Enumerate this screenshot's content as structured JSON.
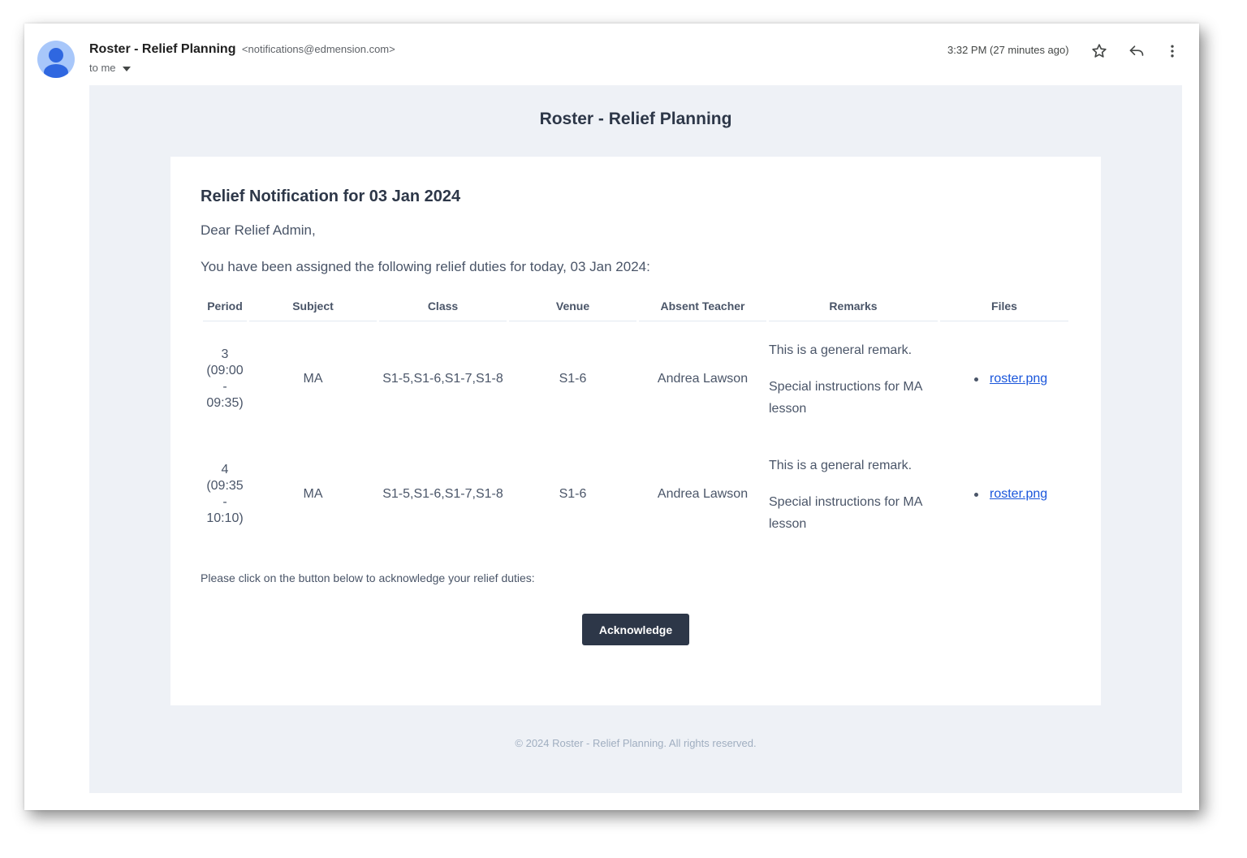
{
  "header": {
    "sender_name": "Roster - Relief Planning",
    "sender_email": "<notifications@edmension.com>",
    "recipient": "to me",
    "time": "3:32 PM (27 minutes ago)",
    "icons": [
      "avatar",
      "chevron-down-icon",
      "star-icon",
      "reply-icon",
      "more-vert-icon"
    ]
  },
  "email": {
    "brand_title": "Roster - Relief Planning",
    "heading": "Relief Notification for 03 Jan 2024",
    "greeting": "Dear Relief Admin,",
    "intro": "You have been assigned the following relief duties for today, 03 Jan 2024:",
    "table": {
      "columns": [
        "Period",
        "Subject",
        "Class",
        "Venue",
        "Absent Teacher",
        "Remarks",
        "Files"
      ],
      "rows": [
        {
          "period_number": "3",
          "period_start": "(09:00",
          "period_sep": "-",
          "period_end": "09:35)",
          "subject": "MA",
          "class": "S1-5,S1-6,S1-7,S1-8",
          "venue": "S1-6",
          "absent_teacher": "Andrea Lawson",
          "remark_general": "This is a general remark.",
          "remark_special": "Special instructions for MA lesson",
          "file": "roster.png"
        },
        {
          "period_number": "4",
          "period_start": "(09:35",
          "period_sep": "-",
          "period_end": "10:10)",
          "subject": "MA",
          "class": "S1-5,S1-6,S1-7,S1-8",
          "venue": "S1-6",
          "absent_teacher": "Andrea Lawson",
          "remark_general": "This is a general remark.",
          "remark_special": "Special instructions for MA lesson",
          "file": "roster.png"
        }
      ]
    },
    "ack_text": "Please click on the button below to acknowledge your relief duties:",
    "ack_button": "Acknowledge",
    "footer": "© 2024 Roster - Relief Planning. All rights reserved."
  },
  "colors": {
    "body_background": "#eef1f6",
    "card_background": "#ffffff",
    "button_background": "#2d3748",
    "link": "#1a56db",
    "avatar": "#a8c7fa"
  }
}
